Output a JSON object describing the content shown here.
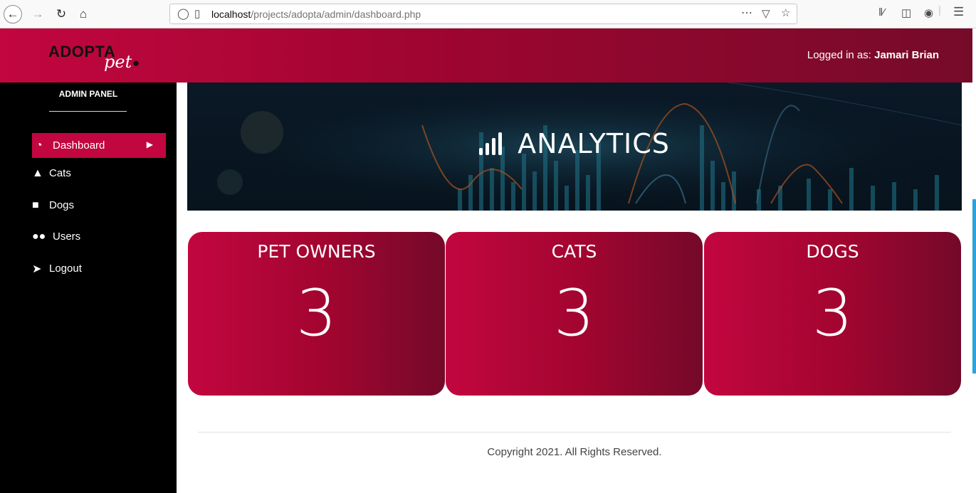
{
  "browser": {
    "url_host": "localhost",
    "url_path": "/projects/adopta/admin/dashboard.php"
  },
  "header": {
    "logo_main": "ADOPTA",
    "logo_sub": "pet",
    "login_prefix": "Logged in as:",
    "login_user": "Jamari Brian"
  },
  "sidebar": {
    "panel_title": "ADMIN PANEL",
    "items": [
      {
        "label": "Dashboard",
        "icon": "tachometer-icon",
        "active": true
      },
      {
        "label": "Cats",
        "icon": "cat-icon"
      },
      {
        "label": "Dogs",
        "icon": "dog-icon"
      },
      {
        "label": "Users",
        "icon": "users-icon"
      },
      {
        "label": "Logout",
        "icon": "logout-icon"
      }
    ]
  },
  "hero": {
    "title": "ANALYTICS",
    "icon": "signal-bars-icon"
  },
  "stats": [
    {
      "label": "PET OWNERS",
      "value": "3"
    },
    {
      "label": "CATS",
      "value": "3"
    },
    {
      "label": "DOGS",
      "value": "3"
    }
  ],
  "footer": {
    "copyright": "Copyright 2021. All Rights Reserved."
  },
  "colors": {
    "brand": "#c2063f",
    "brand_dark": "#760b29",
    "sidebar_bg": "#000000"
  }
}
